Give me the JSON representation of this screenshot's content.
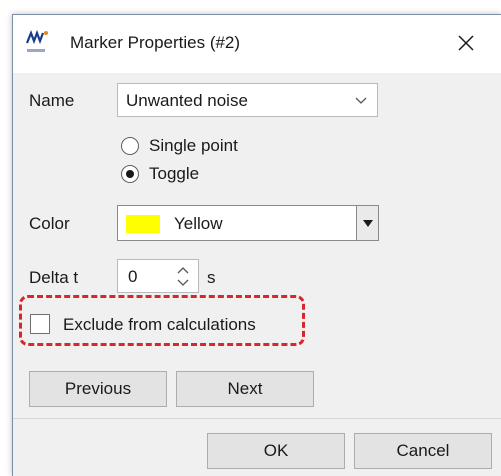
{
  "window": {
    "title": "Marker Properties (#2)",
    "close_icon": "close-icon",
    "app_icon": "nanowave-app-icon"
  },
  "form": {
    "name_label": "Name",
    "name_value": "Unwanted noise",
    "radio_options": [
      {
        "label": "Single point",
        "checked": false
      },
      {
        "label": "Toggle",
        "checked": true
      }
    ],
    "color_label": "Color",
    "color_value": "Yellow",
    "color_swatch": "#ffff00",
    "delta_label": "Delta t",
    "delta_value": "0",
    "delta_unit": "s",
    "exclude_label": "Exclude from calculations",
    "exclude_checked": false
  },
  "buttons": {
    "previous": "Previous",
    "next": "Next",
    "ok": "OK",
    "cancel": "Cancel"
  },
  "colors": {
    "highlight": "#d7262d",
    "dialog_bg": "#f0f0f0"
  }
}
